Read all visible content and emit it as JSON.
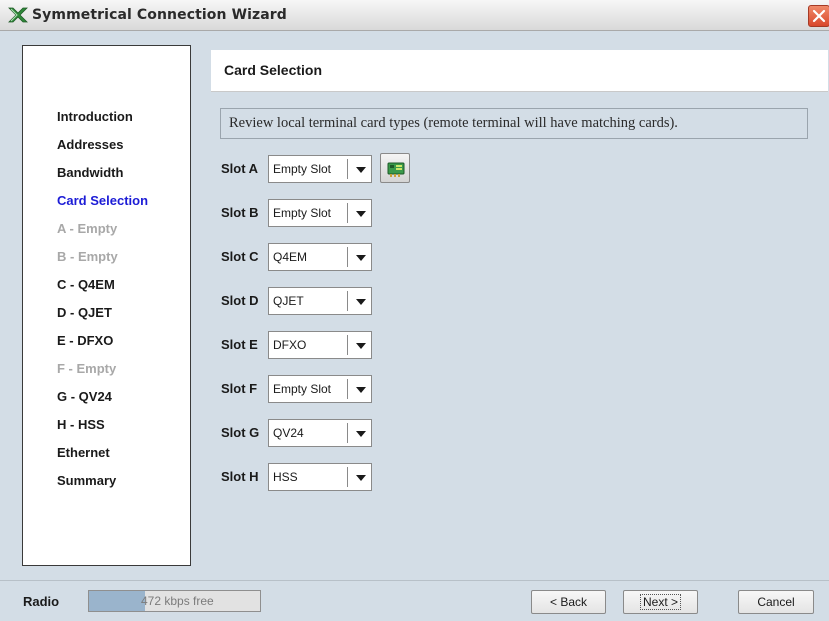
{
  "window": {
    "title": "Symmetrical Connection Wizard",
    "icon": "wizard-app-icon",
    "close_icon": "close-icon"
  },
  "sidebar": {
    "items": [
      {
        "label": "Introduction",
        "state": "normal"
      },
      {
        "label": "Addresses",
        "state": "normal"
      },
      {
        "label": "Bandwidth",
        "state": "normal"
      },
      {
        "label": "Card Selection",
        "state": "active"
      },
      {
        "label": "A - Empty",
        "state": "disabled"
      },
      {
        "label": "B - Empty",
        "state": "disabled"
      },
      {
        "label": "C - Q4EM",
        "state": "normal"
      },
      {
        "label": "D - QJET",
        "state": "normal"
      },
      {
        "label": "E - DFXO",
        "state": "normal"
      },
      {
        "label": "F - Empty",
        "state": "disabled"
      },
      {
        "label": "G - QV24",
        "state": "normal"
      },
      {
        "label": "H - HSS",
        "state": "normal"
      },
      {
        "label": "Ethernet",
        "state": "normal"
      },
      {
        "label": "Summary",
        "state": "normal"
      }
    ]
  },
  "header": {
    "title": "Card Selection"
  },
  "description": "Review local terminal card types (remote terminal will have matching cards).",
  "slots": [
    {
      "label": "Slot A",
      "value": "Empty Slot",
      "has_card_button": true
    },
    {
      "label": "Slot B",
      "value": "Empty Slot",
      "has_card_button": false
    },
    {
      "label": "Slot C",
      "value": "Q4EM",
      "has_card_button": false
    },
    {
      "label": "Slot D",
      "value": "QJET",
      "has_card_button": false
    },
    {
      "label": "Slot E",
      "value": "DFXO",
      "has_card_button": false
    },
    {
      "label": "Slot F",
      "value": "Empty Slot",
      "has_card_button": false
    },
    {
      "label": "Slot G",
      "value": "QV24",
      "has_card_button": false
    },
    {
      "label": "Slot H",
      "value": "HSS",
      "has_card_button": false
    }
  ],
  "card_button_icon": "network-card-icon",
  "status": {
    "radio_label": "Radio",
    "bandwidth_text": "472 kbps free",
    "bandwidth_fill_fraction": 0.33
  },
  "buttons": {
    "back": "< Back",
    "next": "Next >",
    "cancel": "Cancel"
  },
  "colors": {
    "active_item": "#1c1cd6",
    "disabled_item": "#a8a8a8",
    "background": "#d3dde6",
    "bandwidth_fill": "#9ab4cc"
  }
}
